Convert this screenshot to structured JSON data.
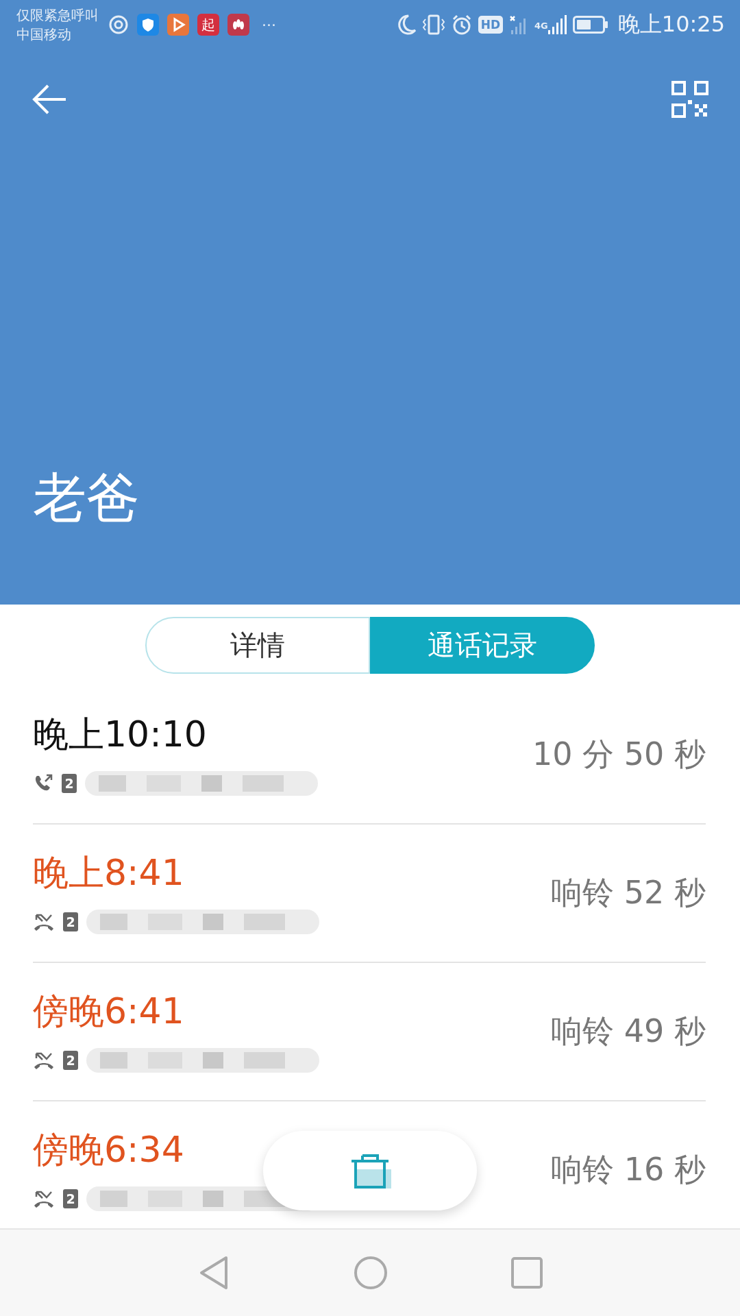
{
  "status_bar": {
    "carrier_lines": [
      "仅限紧急呼叫",
      "中国移动"
    ],
    "notification_icons": [
      {
        "kind": "swirl"
      },
      {
        "kind": "shield",
        "color": "#1e88e5"
      },
      {
        "kind": "play",
        "color": "#e8763c"
      },
      {
        "kind": "text",
        "color": "#d32f3f",
        "label": "起"
      },
      {
        "kind": "flower",
        "color": "#c0394b"
      }
    ],
    "more": "···",
    "hd_badge": "HD",
    "network_label": "4G",
    "time": "晚上10:25"
  },
  "header": {
    "contact_name": "老爸"
  },
  "tabs": [
    {
      "label": "详情",
      "selected": false
    },
    {
      "label": "通话记录",
      "selected": true
    }
  ],
  "calls": [
    {
      "kind": "outgoing",
      "time": "晚上10:10",
      "sim": "2",
      "duration": "10 分 50 秒"
    },
    {
      "kind": "missed",
      "time": "晚上8:41",
      "sim": "2",
      "duration": "响铃 52 秒"
    },
    {
      "kind": "missed",
      "time": "傍晚6:41",
      "sim": "2",
      "duration": "响铃 49 秒"
    },
    {
      "kind": "missed",
      "time": "傍晚6:34",
      "sim": "2",
      "duration": "响铃 16 秒"
    }
  ]
}
